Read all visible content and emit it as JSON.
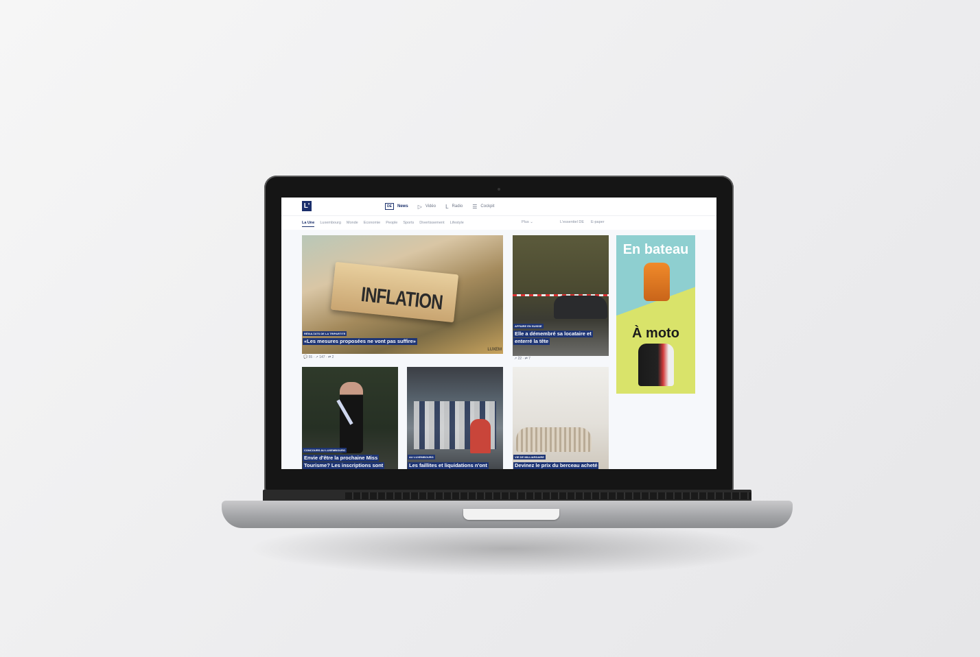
{
  "site": {
    "logo_text": "L'"
  },
  "topnav": [
    {
      "label": "News",
      "icon": "news-icon",
      "glyph": "DE"
    },
    {
      "label": "Vidéo",
      "icon": "play-icon",
      "glyph": "▷"
    },
    {
      "label": "Radio",
      "icon": "radio-icon",
      "glyph": "L"
    },
    {
      "label": "Cockpit",
      "icon": "cockpit-icon",
      "glyph": "☰"
    }
  ],
  "categories": [
    "La Une",
    "Luxembourg",
    "Monde",
    "Economie",
    "People",
    "Sports",
    "Divertissement",
    "Lifestyle"
  ],
  "plus_label": "Plus ⌄",
  "external_links": [
    "L'essentiel DE",
    "E-paper"
  ],
  "articles": [
    {
      "tag": "RÉSULTATS DE LA TRIPARTITE",
      "headline": "«Les mesures proposées ne vont pas suffire»",
      "image_text": "INFLATION",
      "watermark": "LUXEM",
      "meta": "💬 55 · ↗ 147 · ⇄ 2"
    },
    {
      "tag": "AFFAIRE EN SUISSE",
      "headline_1": "Elle a démembré sa locataire et",
      "headline_2": "enterré la tête",
      "meta": "↗ 22 · ⇄ 7"
    },
    {
      "tag": "CONCOURS AU LUXEMBOURG",
      "headline_1": "Envie d'être la prochaine Miss",
      "headline_2": "Tourisme? Les inscriptions sont"
    },
    {
      "tag": "AU LUXEMBOURG",
      "headline": "Les faillites et liquidations n'ont"
    },
    {
      "tag": "VIE DE MILLIARDAIRE",
      "headline": "Devinez le prix du berceau acheté"
    }
  ],
  "ad": {
    "top_text": "En bateau",
    "bottom_text": "À moto",
    "colors": {
      "top": "#8ecfd0",
      "bottom": "#d9e36a"
    }
  }
}
